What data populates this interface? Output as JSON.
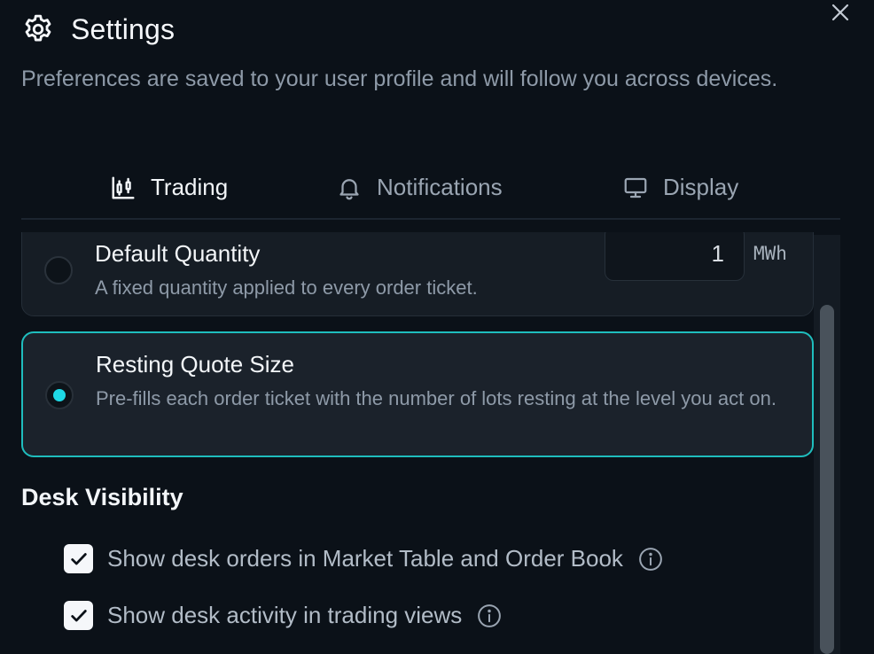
{
  "header": {
    "title": "Settings",
    "subtitle": "Preferences are saved to your user profile and will follow you across devices."
  },
  "tabs": [
    {
      "label": "Trading",
      "icon": "chart-icon",
      "active": true
    },
    {
      "label": "Notifications",
      "icon": "bell-icon",
      "active": false
    },
    {
      "label": "Display",
      "icon": "monitor-icon",
      "active": false
    }
  ],
  "quantity_options": [
    {
      "title": "Default Quantity",
      "description": "A fixed quantity applied to every order ticket.",
      "selected": false,
      "input_value": "1",
      "unit": "MWh"
    },
    {
      "title": "Resting Quote Size",
      "description": "Pre-fills each order ticket with the number of lots resting at the level you act on.",
      "selected": true
    }
  ],
  "desk_visibility": {
    "title": "Desk Visibility",
    "options": [
      {
        "label": "Show desk orders in Market Table and Order Book",
        "checked": true
      },
      {
        "label": "Show desk activity in trading views",
        "checked": true
      }
    ]
  },
  "colors": {
    "background": "#0b1118",
    "accent": "#1ed9e6",
    "selected_border": "#1fbdbd"
  }
}
